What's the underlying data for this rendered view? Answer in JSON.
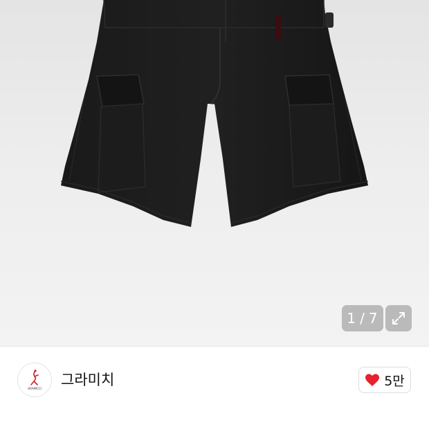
{
  "gallery": {
    "image_alt": "black cargo shorts",
    "counter_current": "1",
    "counter_separator": "/",
    "counter_total": "7"
  },
  "shop": {
    "logo_text": "GRAMICCI",
    "name": "그라미치",
    "like_count": "5만",
    "heart_color": "#e8212e"
  },
  "icons": {
    "expand": "expand-icon",
    "heart": "heart-icon",
    "logo": "climber-logo-icon"
  }
}
